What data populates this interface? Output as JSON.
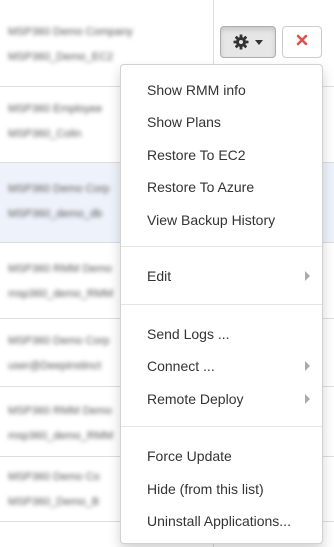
{
  "rows": [
    {
      "line1": "MSP360 Demo Company",
      "line2": "MSP360_Demo_EC2"
    },
    {
      "line1": "MSP360 Employee",
      "line2": "MSP360_Colin"
    },
    {
      "line1": "MSP360 Demo Corp",
      "line2": "MSP360_demo_db"
    },
    {
      "line1": "MSP360 RMM Demo",
      "line2": "msp360_demo_RMM"
    },
    {
      "line1": "MSP360 Demo Corp",
      "line2": "user@Deepinstinct"
    },
    {
      "line1": "MSP360 RMM Demo",
      "line2": "msp360_demo_RMM"
    },
    {
      "line1": "MSP360 Demo Co",
      "line2": "MSP360_Demo_B"
    }
  ],
  "actions": {
    "settings_icon": "gear-icon",
    "dropdown_icon": "caret-down-icon",
    "delete_icon": "close-icon",
    "delete_color": "#d9534f"
  },
  "menu": {
    "items": [
      {
        "label": "Show RMM info"
      },
      {
        "label": "Show Plans"
      },
      {
        "label": "Restore To EC2"
      },
      {
        "label": "Restore To Azure"
      },
      {
        "label": "View Backup History"
      },
      {
        "label": "Edit"
      },
      {
        "label": "Send Logs ..."
      },
      {
        "label": "Connect ..."
      },
      {
        "label": "Remote Deploy"
      },
      {
        "label": "Force Update"
      },
      {
        "label": "Hide (from this list)"
      },
      {
        "label": "Uninstall Applications..."
      }
    ]
  }
}
